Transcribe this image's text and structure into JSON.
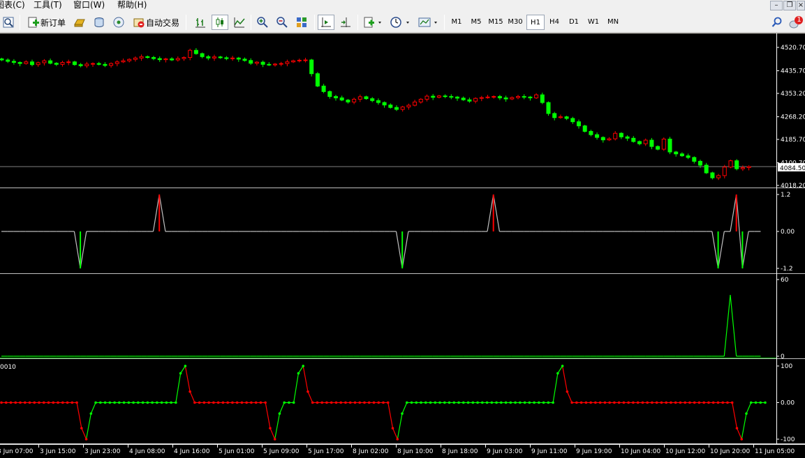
{
  "menu": {
    "items": [
      "图表(C)",
      "工具(T)",
      "窗口(W)",
      "帮助(H)"
    ]
  },
  "window_controls": {
    "minimize": "–",
    "restore": "❐",
    "close": "×"
  },
  "toolbar": {
    "new_order_label": "新订单",
    "auto_trade_label": "自动交易",
    "timeframes": [
      "M1",
      "M5",
      "M15",
      "M30",
      "H1",
      "H4",
      "D1",
      "W1",
      "MN"
    ],
    "active_timeframe": "H1",
    "notification_count": "1",
    "icons": [
      "properties-icon",
      "new-order-icon",
      "gold-bar-icon",
      "history-icon",
      "signal-icon",
      "auto-trade-icon",
      "bar-chart-icon",
      "candlestick-icon",
      "line-chart-icon",
      "zoom-in-icon",
      "zoom-out-icon",
      "tile-windows-icon",
      "chart-shift-icon",
      "autoscroll-icon",
      "indicators-icon",
      "period-clock-icon",
      "templates-icon",
      "search-icon",
      "notifications-icon"
    ]
  },
  "colors": {
    "bull": "#00ff00",
    "bear": "#ff0000",
    "axis": "#ffffff",
    "bidline": "#808080",
    "panel_border": "#c0c0c0"
  },
  "chart_data": [
    {
      "type": "candlestick",
      "panel": "price",
      "y_ticks": [
        "4520.70",
        "4435.70",
        "4353.20",
        "4268.20",
        "4185.70",
        "4100.70",
        "4018.20"
      ],
      "current_price": "4084.50",
      "ylim": [
        4010,
        4540
      ],
      "closes": [
        4475,
        4470,
        4466,
        4462,
        4468,
        4458,
        4465,
        4472,
        4463,
        4459,
        4466,
        4468,
        4458,
        4454,
        4460,
        4462,
        4459,
        4455,
        4462,
        4468,
        4472,
        4477,
        4482,
        4487,
        4484,
        4480,
        4476,
        4479,
        4475,
        4480,
        4484,
        4510,
        4498,
        4487,
        4482,
        4486,
        4483,
        4480,
        4482,
        4478,
        4473,
        4463,
        4467,
        4459,
        4457,
        4460,
        4462,
        4468,
        4472,
        4474,
        4475,
        4425,
        4380,
        4360,
        4342,
        4337,
        4329,
        4322,
        4332,
        4341,
        4334,
        4327,
        4320,
        4311,
        4302,
        4295,
        4304,
        4310,
        4322,
        4332,
        4343,
        4339,
        4344,
        4342,
        4340,
        4336,
        4330,
        4325,
        4335,
        4338,
        4340,
        4342,
        4337,
        4333,
        4338,
        4342,
        4340,
        4337,
        4348,
        4320,
        4280,
        4265,
        4268,
        4262,
        4250,
        4235,
        4215,
        4203,
        4193,
        4184,
        4188,
        4208,
        4195,
        4190,
        4178,
        4170,
        4183,
        4160,
        4150,
        4187,
        4140,
        4133,
        4126,
        4120,
        4106,
        4092,
        4064,
        4046,
        4054,
        4085,
        4108,
        4079,
        4083,
        4087
      ],
      "x_ticks": [
        "3 Jun 07:00",
        "3 Jun 15:00",
        "3 Jun 23:00",
        "4 Jun 08:00",
        "4 Jun 16:00",
        "5 Jun 01:00",
        "5 Jun 09:00",
        "5 Jun 17:00",
        "8 Jun 02:00",
        "8 Jun 10:00",
        "8 Jun 18:00",
        "9 Jun 03:00",
        "9 Jun 11:00",
        "9 Jun 19:00",
        "10 Jun 04:00",
        "10 Jun 12:00",
        "10 Jun 20:00",
        "11 Jun 05:00"
      ]
    },
    {
      "type": "line",
      "panel": "indicator-1",
      "y_ticks": [
        "1.2",
        "0.00",
        "-1.2"
      ],
      "ylim": [
        -1.2,
        1.2
      ],
      "series": [
        {
          "values": [
            0,
            0,
            0,
            0,
            0,
            0,
            0,
            0,
            0,
            0,
            0,
            0,
            0,
            -1.2,
            0,
            0,
            0,
            0,
            0,
            0,
            0,
            0,
            0,
            0,
            0,
            0,
            1.2,
            0,
            0,
            0,
            0,
            0,
            0,
            0,
            0,
            0,
            0,
            0,
            0,
            0,
            0,
            0,
            0,
            0,
            0,
            0,
            0,
            0,
            0,
            0,
            0,
            0,
            0,
            0,
            0,
            0,
            0,
            0,
            0,
            0,
            0,
            0,
            0,
            0,
            0,
            0,
            -1.2,
            0,
            0,
            0,
            0,
            0,
            0,
            0,
            0,
            0,
            0,
            0,
            0,
            0,
            0,
            1.2,
            0,
            0,
            0,
            0,
            0,
            0,
            0,
            0,
            0,
            0,
            0,
            0,
            0,
            0,
            0,
            0,
            0,
            0,
            0,
            0,
            0,
            0,
            0,
            0,
            0,
            0,
            0,
            0,
            0,
            0,
            0,
            0,
            0,
            0,
            0,
            0,
            -1.2,
            0,
            0,
            1.2,
            -1.2,
            0,
            0,
            0
          ]
        }
      ]
    },
    {
      "type": "line",
      "panel": "indicator-2",
      "y_ticks": [
        "60",
        "0"
      ],
      "ylim": [
        0,
        60
      ],
      "series": [
        {
          "values": [
            0,
            0,
            0,
            0,
            0,
            0,
            0,
            0,
            0,
            0,
            0,
            0,
            0,
            0,
            0,
            0,
            0,
            0,
            0,
            0,
            0,
            0,
            0,
            0,
            0,
            0,
            0,
            0,
            0,
            0,
            0,
            0,
            0,
            0,
            0,
            0,
            0,
            0,
            0,
            0,
            0,
            0,
            0,
            0,
            0,
            0,
            0,
            0,
            0,
            0,
            0,
            0,
            0,
            0,
            0,
            0,
            0,
            0,
            0,
            0,
            0,
            0,
            0,
            0,
            0,
            0,
            0,
            0,
            0,
            0,
            0,
            0,
            0,
            0,
            0,
            0,
            0,
            0,
            0,
            0,
            0,
            0,
            0,
            0,
            0,
            0,
            0,
            0,
            0,
            0,
            0,
            0,
            0,
            0,
            0,
            0,
            0,
            0,
            0,
            0,
            0,
            0,
            0,
            0,
            0,
            0,
            0,
            0,
            0,
            0,
            0,
            0,
            0,
            0,
            0,
            0,
            0,
            0,
            0,
            0,
            48,
            0,
            0,
            0,
            0,
            0
          ]
        }
      ]
    },
    {
      "type": "line",
      "panel": "indicator-3",
      "label": "0010",
      "y_ticks": [
        "100",
        "0.00",
        "-100"
      ],
      "ylim": [
        -100,
        100
      ],
      "series": [
        {
          "values": [
            0,
            0,
            0,
            0,
            0,
            0,
            0,
            0,
            0,
            0,
            0,
            0,
            0,
            0,
            0,
            0,
            0,
            -70,
            -100,
            -30,
            0,
            0,
            0,
            0,
            0,
            0,
            0,
            0,
            0,
            0,
            0,
            0,
            0,
            0,
            0,
            0,
            0,
            0,
            80,
            100,
            30,
            0,
            0,
            0,
            0,
            0,
            0,
            0,
            0,
            0,
            0,
            0,
            0,
            0,
            0,
            0,
            0,
            -70,
            -100,
            -30,
            0,
            0,
            0,
            80,
            100,
            30,
            0,
            0,
            0,
            0,
            0,
            0,
            0,
            0,
            0,
            0,
            0,
            0,
            0,
            0,
            0,
            0,
            0,
            -70,
            -100,
            -30,
            0,
            0,
            0,
            0,
            0,
            0,
            0,
            0,
            0,
            0,
            0,
            0,
            0,
            0,
            0,
            0,
            0,
            0,
            0,
            0,
            0,
            0,
            0,
            0,
            0,
            0,
            0,
            0,
            0,
            0,
            0,
            0,
            80,
            100,
            30,
            0,
            0,
            0,
            0,
            0,
            0,
            0,
            0,
            0,
            0,
            0,
            0,
            0,
            0,
            0,
            0,
            0,
            0,
            0,
            0,
            0,
            0,
            0,
            0,
            0,
            0,
            0,
            0,
            0,
            0,
            0,
            0,
            0,
            0,
            0,
            -70,
            -100,
            -30,
            0,
            0,
            0,
            0
          ]
        }
      ]
    }
  ]
}
